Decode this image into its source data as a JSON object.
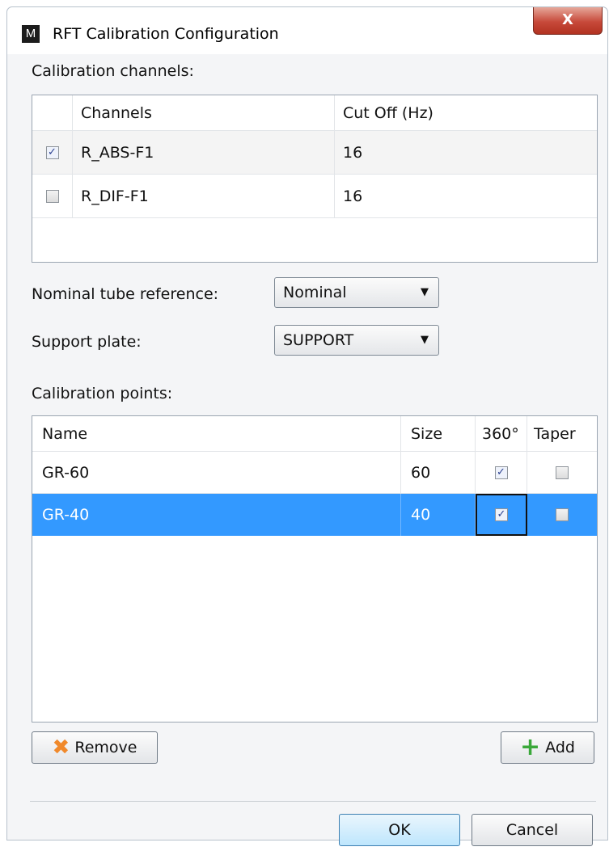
{
  "window": {
    "title": "RFT Calibration Configuration",
    "app_icon": "M",
    "close_glyph": "X"
  },
  "channels_section": {
    "label": "Calibration channels:",
    "columns": [
      "Channels",
      "Cut Off (Hz)"
    ],
    "rows": [
      {
        "checked": true,
        "name": "R_ABS-F1",
        "cutoff": "16"
      },
      {
        "checked": false,
        "name": "R_DIF-F1",
        "cutoff": "16"
      }
    ]
  },
  "nominal": {
    "label": "Nominal tube reference:",
    "value": "Nominal"
  },
  "support": {
    "label": "Support plate:",
    "value": "SUPPORT"
  },
  "points_section": {
    "label": "Calibration points:",
    "columns": [
      "Name",
      "Size",
      "360°",
      "Taper"
    ],
    "rows": [
      {
        "name": "GR-60",
        "size": "60",
        "deg360": true,
        "taper": false,
        "selected": false
      },
      {
        "name": "GR-40",
        "size": "40",
        "deg360": true,
        "taper": false,
        "selected": true
      }
    ]
  },
  "buttons": {
    "remove": "Remove",
    "add": "Add",
    "ok": "OK",
    "cancel": "Cancel"
  },
  "icons": {
    "remove": "x-icon",
    "add": "plus-icon"
  },
  "colors": {
    "selection": "#3399ff",
    "close": "#c7493a",
    "add_icon": "#3aa83a",
    "remove_icon": "#f0892b"
  }
}
